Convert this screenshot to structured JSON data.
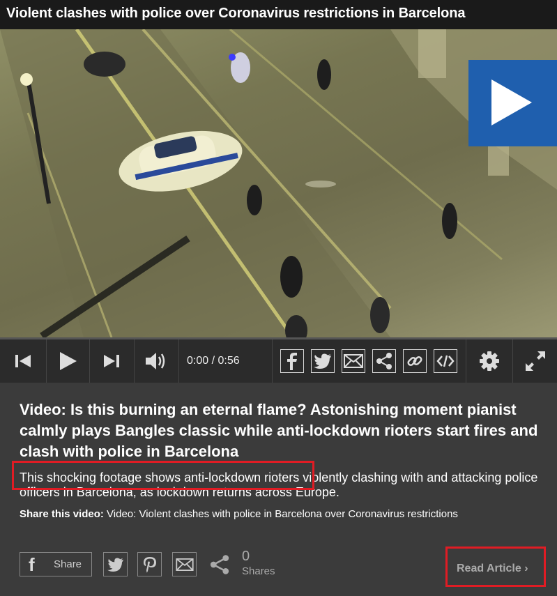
{
  "video": {
    "title": "Violent clashes with police over Coronavirus restrictions in Barcelona",
    "time_current": "0:00",
    "time_separator": "/",
    "time_duration": "0:56",
    "progress": 0
  },
  "controls": {
    "prev_icon": "skip-back-icon",
    "play_icon": "play-icon",
    "next_icon": "skip-forward-icon",
    "volume_icon": "volume-icon",
    "share_icons": [
      "facebook-icon",
      "twitter-icon",
      "email-icon",
      "share-icon",
      "link-icon",
      "embed-icon"
    ],
    "settings_icon": "gear-icon",
    "fullscreen_icon": "fullscreen-icon"
  },
  "article": {
    "headline": "Video: Is this burning an eternal flame? Astonishing moment pianist calmly plays Bangles classic while anti-lockdown rioters start fires and clash with police in Barcelona",
    "description": "This shocking footage shows anti-lockdown rioters violently clashing with and attacking police officers in Barcelona, as lockdown returns across Europe.",
    "share_prefix": "Share this video:",
    "share_text": " Video: Violent clashes with police in Barcelona over Coronavirus restrictions"
  },
  "social": {
    "facebook_letter": "f",
    "facebook_label": "Share",
    "share_count": "0",
    "share_count_label": "Shares",
    "read_article_label": "Read Article",
    "read_article_chevron": "›"
  },
  "colors": {
    "accent_blue": "#1f5fae",
    "highlight_red": "#e01c24",
    "panel_bg": "#3b3b3b",
    "controls_bg": "#2b2b2b"
  }
}
